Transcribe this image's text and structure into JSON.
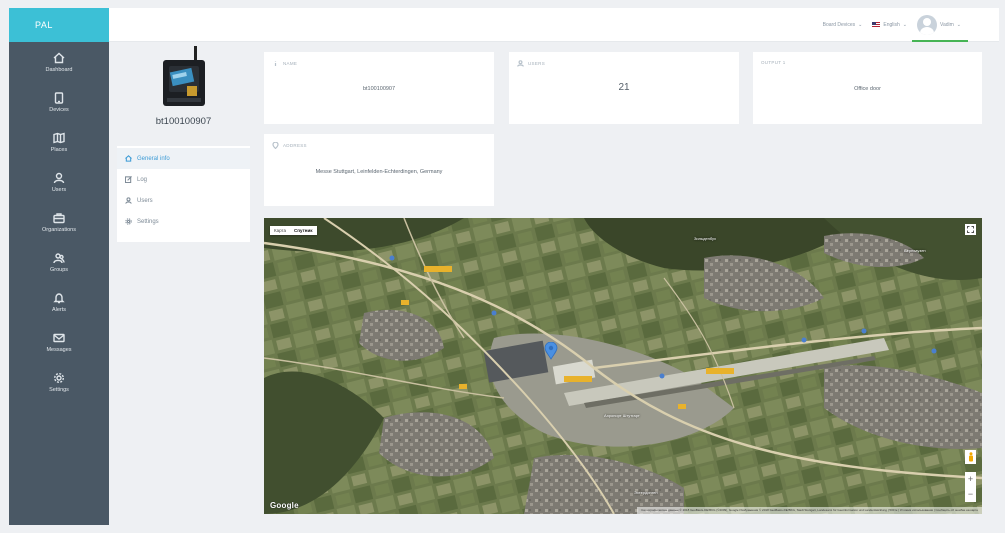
{
  "brand": {
    "name": "PAL"
  },
  "sidebar": {
    "items": [
      {
        "label": "Dashboard",
        "icon": "home-icon"
      },
      {
        "label": "Devices",
        "icon": "device-icon"
      },
      {
        "label": "Places",
        "icon": "map-icon"
      },
      {
        "label": "Users",
        "icon": "user-icon"
      },
      {
        "label": "Organizations",
        "icon": "briefcase-icon"
      },
      {
        "label": "Groups",
        "icon": "group-icon"
      },
      {
        "label": "Alerts",
        "icon": "bell-icon"
      },
      {
        "label": "Messages",
        "icon": "mail-icon"
      },
      {
        "label": "Settings",
        "icon": "gear-icon"
      }
    ]
  },
  "topbar": {
    "devices_select": "Board Devices",
    "language": "English",
    "user": "Vadim"
  },
  "device": {
    "title": "bt100100907",
    "menu": [
      {
        "label": "General info",
        "icon": "home-icon"
      },
      {
        "label": "Log",
        "icon": "edit-icon"
      },
      {
        "label": "Users",
        "icon": "user-icon"
      },
      {
        "label": "Settings",
        "icon": "gear-icon"
      }
    ]
  },
  "cards": {
    "name": {
      "label": "NAME",
      "value": "bt100100907"
    },
    "users": {
      "label": "USERS",
      "value": "21"
    },
    "output": {
      "label": "OUTPUT 1",
      "value": "Office door"
    },
    "address": {
      "label": "ADDRESS",
      "value": "Messe Stuttgart, Leinfelden-Echterdingen, Germany"
    }
  },
  "map": {
    "type_options": [
      "Карта",
      "Спутник"
    ],
    "google": "Google",
    "attribution": "Картографические данные © 2018 GeoBasis-DE/BKG (©2009), Google Изображения © 2018 GeoBasis-DE/BKG, Stadt Stuttgart, Landesamt für Geoinformation und Landentwicklung | 500 м | Условия использования | Сообщить об ошибке на карте",
    "labels": {
      "airport": "Аэропорт Штутгарт",
      "place1": "Бернхаузен",
      "place2": "Зильденбух",
      "place3": "Эхтердинген"
    }
  },
  "colors": {
    "sidebar": "#4a5865",
    "brand": "#3cc0d6",
    "accent": "#3c9bd6",
    "user_underline": "#46b455",
    "pin": "#4a90e2"
  }
}
